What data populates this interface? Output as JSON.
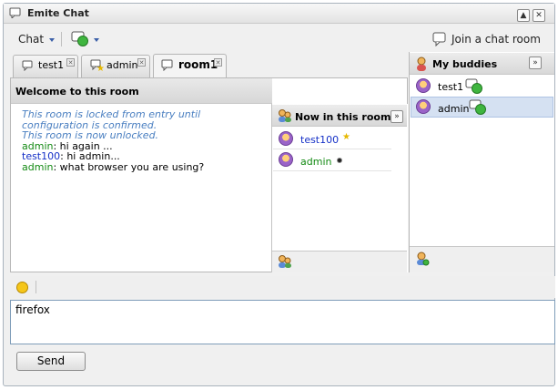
{
  "window": {
    "title": "Emite Chat"
  },
  "toolbar": {
    "chat_menu_label": "Chat",
    "join_room_label": "Join a chat room"
  },
  "tabs": [
    {
      "label": "test1",
      "active": false
    },
    {
      "label": "admin",
      "active": false
    },
    {
      "label": "room1",
      "active": true
    }
  ],
  "room": {
    "header": "Welcome to this room",
    "messages": [
      {
        "type": "info",
        "text": "This room is locked from entry until configuration is confirmed."
      },
      {
        "type": "info",
        "text": "This room is now unlocked."
      },
      {
        "type": "msg",
        "nick": "admin",
        "text": ": hi again ..."
      },
      {
        "type": "msg",
        "nick": "test100",
        "text": ": hi admin..."
      },
      {
        "type": "msg",
        "nick": "admin",
        "text": ": what browser you are using?"
      }
    ]
  },
  "occupants": {
    "header": "Now in this room",
    "items": [
      {
        "name": "test100",
        "color": "#1530c7",
        "marker": "star-icon"
      },
      {
        "name": "admin",
        "color": "#138a13",
        "marker": "dot-icon"
      }
    ]
  },
  "buddies": {
    "header": "My buddies",
    "items": [
      {
        "name": "test1",
        "selected": false
      },
      {
        "name": "admin",
        "selected": true
      }
    ]
  },
  "input": {
    "value": "firefox"
  },
  "send_label": "Send",
  "colors": {
    "info_text": "#4a7fc1",
    "selection": "#d5e1f2",
    "online": "#3fb53f"
  }
}
